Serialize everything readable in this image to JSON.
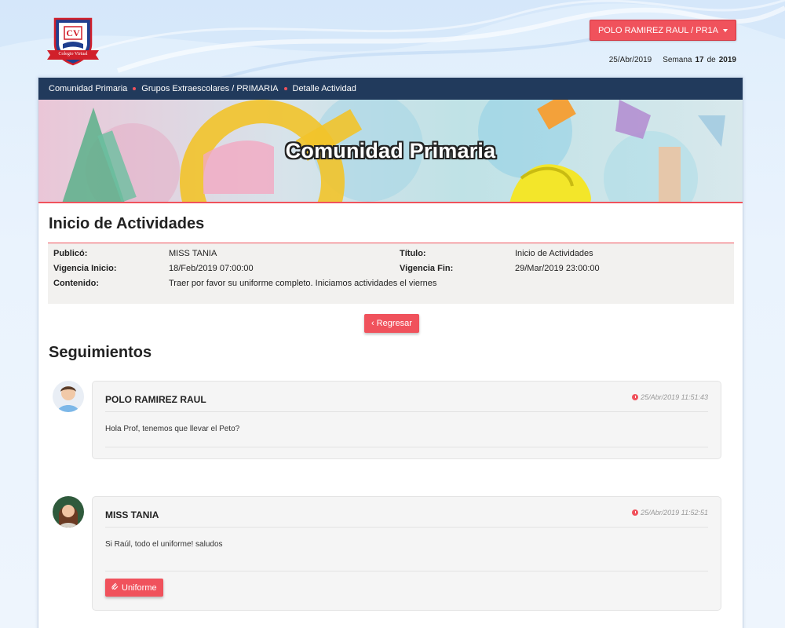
{
  "header": {
    "logo_text": "CV",
    "logo_ribbon": "Colegio Virtual",
    "user_button": "POLO RAMIREZ RAUL / PR1A",
    "date": "25/Abr/2019",
    "week_label": "Semana",
    "week_number": "17",
    "week_of": "de",
    "year": "2019"
  },
  "breadcrumb": [
    "Comunidad Primaria",
    "Grupos Extraescolares / PRIMARIA",
    "Detalle Actividad"
  ],
  "banner_title": "Comunidad Primaria",
  "activity": {
    "title": "Inicio de Actividades",
    "publico_label": "Publicó:",
    "publico": "MISS TANIA",
    "titulo_label": "Título:",
    "titulo": "Inicio de Actividades",
    "vigencia_inicio_label": "Vigencia Inicio:",
    "vigencia_inicio": "18/Feb/2019 07:00:00",
    "vigencia_fin_label": "Vigencia Fin:",
    "vigencia_fin": "29/Mar/2019 23:00:00",
    "contenido_label": "Contenido:",
    "contenido": "Traer por favor su uniforme completo. Iniciamos actividades el viernes"
  },
  "regresar_button": "Regresar",
  "seguimientos_title": "Seguimientos",
  "comments": [
    {
      "author": "POLO RAMIREZ RAUL",
      "time": "25/Abr/2019 11:51:43",
      "text": "Hola Prof, tenemos que llevar el Peto?"
    },
    {
      "author": "MISS TANIA",
      "time": "25/Abr/2019 11:52:51",
      "text": "Si Raúl, todo el uniforme! saludos",
      "attachment": "Uniforme"
    }
  ],
  "colors": {
    "accent": "#f0525c",
    "navbar": "#213a5c"
  }
}
